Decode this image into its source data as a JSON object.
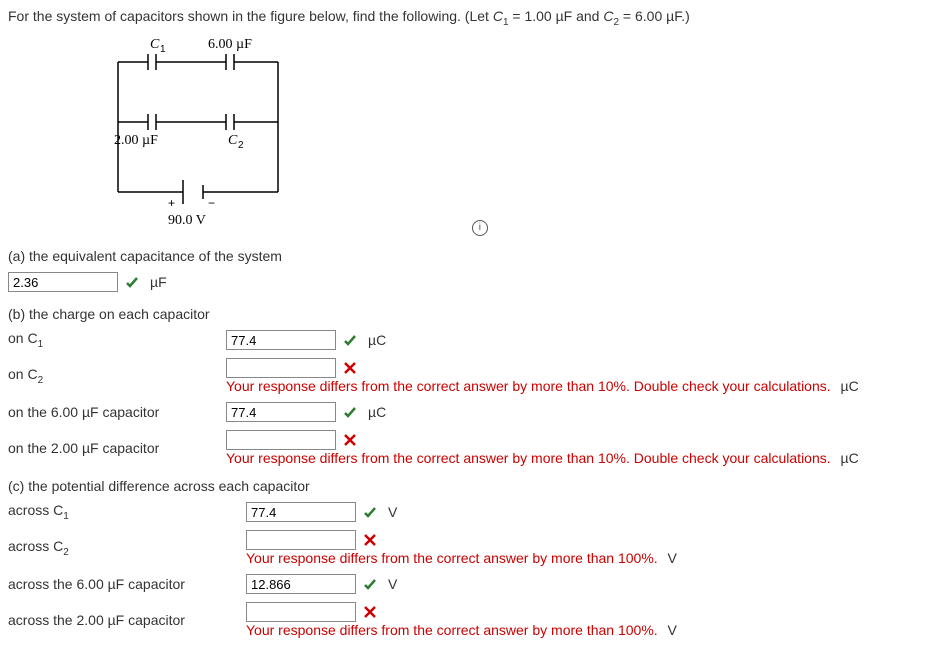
{
  "problem": {
    "prompt_prefix": "For the system of capacitors shown in the figure below, find the following. (Let ",
    "c1_eq": "C",
    "c1_sub": "1",
    "c1_val": " = 1.00 µF and ",
    "c2_eq": "C",
    "c2_sub": "2",
    "c2_val": " = 6.00 µF.)"
  },
  "figure": {
    "c1_label": "C",
    "c1_sub": "1",
    "top_cap": "6.00 µF",
    "bottom_cap": "2.00 µF",
    "c2_label": "C",
    "c2_sub": "2",
    "plus": "+",
    "minus": "−",
    "voltage": "90.0 V"
  },
  "a": {
    "title": "(a) the equivalent capacitance of the system",
    "value": "2.36",
    "unit": "µF"
  },
  "b": {
    "title": "(b) the charge on each capacitor",
    "rows": [
      {
        "label_pre": "on C",
        "label_sub": "1",
        "value": "77.4",
        "status": "correct",
        "unit": "µC"
      },
      {
        "label_pre": "on C",
        "label_sub": "2",
        "value": "",
        "status": "wrong",
        "unit": "µC",
        "error": "Your response differs from the correct answer by more than 10%. Double check your calculations."
      },
      {
        "label_plain": "on the 6.00 µF capacitor",
        "value": "77.4",
        "status": "correct",
        "unit": "µC"
      },
      {
        "label_plain": "on the 2.00 µF capacitor",
        "value": "",
        "status": "wrong",
        "unit": "µC",
        "error": "Your response differs from the correct answer by more than 10%. Double check your calculations."
      }
    ]
  },
  "c": {
    "title": "(c) the potential difference across each capacitor",
    "rows": [
      {
        "label_pre": "across C",
        "label_sub": "1",
        "value": "77.4",
        "status": "correct",
        "unit": "V"
      },
      {
        "label_pre": "across C",
        "label_sub": "2",
        "value": "",
        "status": "wrong",
        "unit": "V",
        "error": "Your response differs from the correct answer by more than 100%."
      },
      {
        "label_plain": "across the 6.00 µF capacitor",
        "value": "12.866",
        "status": "correct",
        "unit": "V"
      },
      {
        "label_plain": "across the 2.00 µF capacitor",
        "value": "",
        "status": "wrong",
        "unit": "V",
        "error": "Your response differs from the correct answer by more than 100%."
      }
    ]
  }
}
